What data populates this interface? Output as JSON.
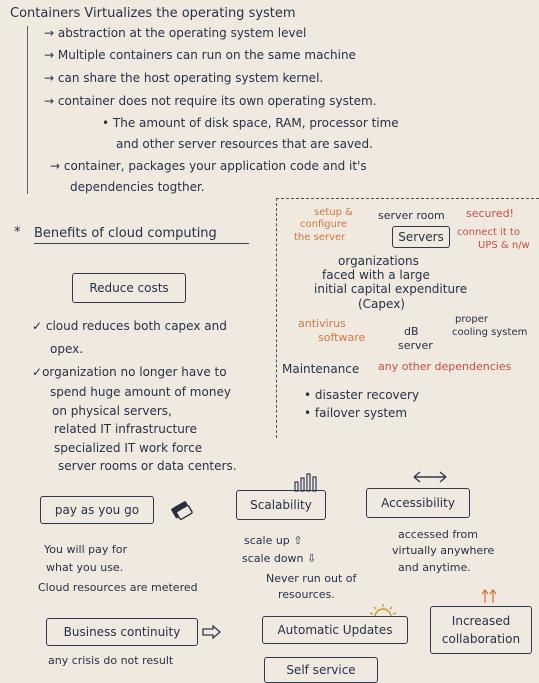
{
  "title": "Containers Virtualizes the operating system",
  "container_points": [
    "abstraction at the operating system level",
    "Multiple containers can run on the same machine",
    "can share the host operating system kernel.",
    "container does not require its own operating system."
  ],
  "container_subpoint_line1": "The amount of disk space, RAM, processor time",
  "container_subpoint_line2": "and other server resources that are saved.",
  "packages_line1": "container, packages your application code and it's",
  "packages_line2": "dependencies togther.",
  "benefits_heading": "Benefits of cloud computing",
  "reduce_costs": {
    "label": "Reduce costs",
    "bullet1_line1": "cloud reduces both capex and",
    "bullet1_line2": "opex.",
    "bullet2_lines": [
      "organization no longer have to",
      "spend huge amount of money",
      "on physical servers,",
      "related IT infrastructure",
      "specialized IT work force",
      "server rooms or data centers."
    ]
  },
  "servers_diagram": {
    "setup_line1": "setup &",
    "setup_line2": "configure",
    "setup_line3": "the server",
    "server_room": "server room",
    "secured": "secured!",
    "servers_label": "Servers",
    "connect_line1": "connect it to",
    "connect_line2": "UPS & n/w",
    "org_line1": "organizations",
    "org_line2": "faced with a large",
    "org_line3": "initial capital expenditure",
    "org_line4": "(Capex)",
    "antivirus_line1": "antivirus",
    "antivirus_line2": "software",
    "db_line1": "dB",
    "db_line2": "server",
    "cooling_line1": "proper",
    "cooling_line2": "cooling system",
    "maintenance": "Maintenance",
    "other_deps": "any other dependencies",
    "maint_points": [
      "disaster recovery",
      "failover system"
    ]
  },
  "payg": {
    "label": "pay as you go",
    "line1": "You will pay for",
    "line2": "what you use.",
    "line3": "Cloud resources are metered"
  },
  "scalability": {
    "label": "Scalability",
    "up": "scale up",
    "down": "scale down",
    "never_line1": "Never run out of",
    "never_line2": "resources."
  },
  "accessibility": {
    "label": "Accessibility",
    "line1": "accessed from",
    "line2": "virtually anywhere",
    "line3": "and anytime."
  },
  "business": {
    "label": "Business continuity",
    "line1": "any crisis do not result"
  },
  "updates": {
    "label": "Automatic Updates"
  },
  "collab": {
    "line1": "Increased",
    "line2": "collaboration"
  },
  "self_service": {
    "label": "Self service"
  }
}
